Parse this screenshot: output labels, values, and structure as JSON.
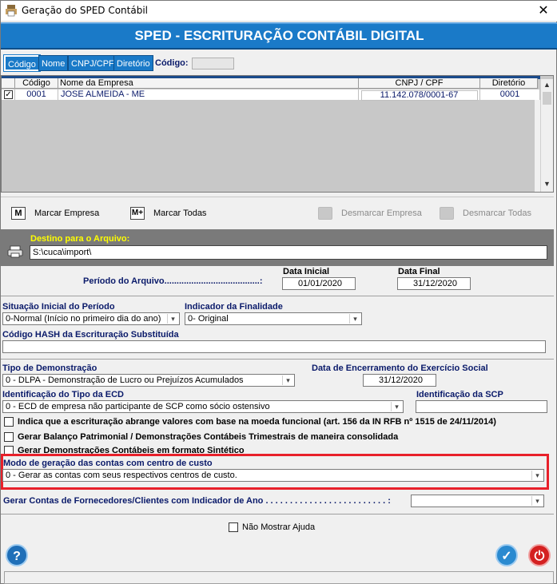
{
  "window": {
    "title": "Geração do SPED Contábil",
    "close_glyph": "✕"
  },
  "banner": {
    "title": "SPED - ESCRITURAÇÃO CONTÁBIL DIGITAL"
  },
  "tabs": [
    {
      "label": "Código",
      "active": true
    },
    {
      "label": "Nome"
    },
    {
      "label": "CNPJ/CPF"
    },
    {
      "label": "Diretório"
    }
  ],
  "search": {
    "label": "Código:",
    "value": ""
  },
  "grid": {
    "columns": [
      "Código",
      "Nome da Empresa",
      "CNPJ / CPF",
      "Diretório"
    ],
    "rows": [
      {
        "checked": true,
        "codigo": "0001",
        "nome": "JOSE ALMEIDA - ME",
        "cnpj": "11.142.078/0001-67",
        "diretorio": "0001"
      }
    ]
  },
  "actions": {
    "marcar_empresa": "Marcar Empresa",
    "marcar_todas": "Marcar Todas",
    "desmarcar_empresa": "Desmarcar Empresa",
    "desmarcar_todas": "Desmarcar Todas",
    "marcar_empresa_icon": "M",
    "marcar_todas_icon": "M+"
  },
  "destino": {
    "label": "Destino para o Arquivo:",
    "value": "S:\\cuca\\import\\"
  },
  "periodo": {
    "label": "Período do Arquivo.......................................:",
    "data_inicial_label": "Data Inicial",
    "data_inicial": "01/01/2020",
    "data_final_label": "Data Final",
    "data_final": "31/12/2020"
  },
  "situacao": {
    "label": "Situação Inicial do Período",
    "value": "0-Normal (Início no primeiro dia do ano)"
  },
  "finalidade": {
    "label": "Indicador da Finalidade",
    "value": "0- Original"
  },
  "hash": {
    "label": "Código HASH da Escrituração Substituída",
    "value": ""
  },
  "demonstracao": {
    "label": "Tipo de Demonstração",
    "value": "0 - DLPA - Demonstração de Lucro ou Prejuízos Acumulados"
  },
  "encerramento": {
    "label": "Data de Encerramento do Exercício Social",
    "value": "31/12/2020"
  },
  "tipo_ecd": {
    "label": "Identificação do Tipo da ECD",
    "value": "0 - ECD de empresa não participante de SCP como sócio ostensivo"
  },
  "scp": {
    "label": "Identificação da SCP",
    "value": ""
  },
  "checks": [
    {
      "label": "Indica que a escrituração abrange valores com base na moeda funcional (art. 156 da IN RFB nº 1515 de 24/11/2014)",
      "checked": false
    },
    {
      "label": "Gerar Balanço Patrimonial / Demonstrações Contábeis Trimestrais de maneira consolidada",
      "checked": false
    },
    {
      "label": "Gerar Demonstrações Contábeis em formato Sintético",
      "checked": false
    }
  ],
  "modo_centro_custo": {
    "label": "Modo de geração das contas com centro de custo",
    "value": "0 - Gerar as contas com seus respectivos centros de custo."
  },
  "fornecedores": {
    "label": "Gerar Contas de Fornecedores/Clientes com Indicador de Ano . . . . . . . . . . . . . . . . . . . . . . . . . :",
    "value": ""
  },
  "nao_mostrar_ajuda": {
    "label": "Não Mostrar Ajuda",
    "checked": false
  },
  "colors": {
    "banner": "#1a7ac8",
    "label_blue": "#0a1a6a",
    "destino_label": "#ffff00",
    "highlight": "#e8202a",
    "help": "#1f6fb8",
    "confirm": "#2a8ad0",
    "power": "#d42020"
  },
  "icons": {
    "help": "?",
    "confirm": "✓",
    "power": "⏻",
    "combo_arrow": "▾",
    "scroll_up": "▲",
    "scroll_down": "▼",
    "check_mark": "✓"
  }
}
